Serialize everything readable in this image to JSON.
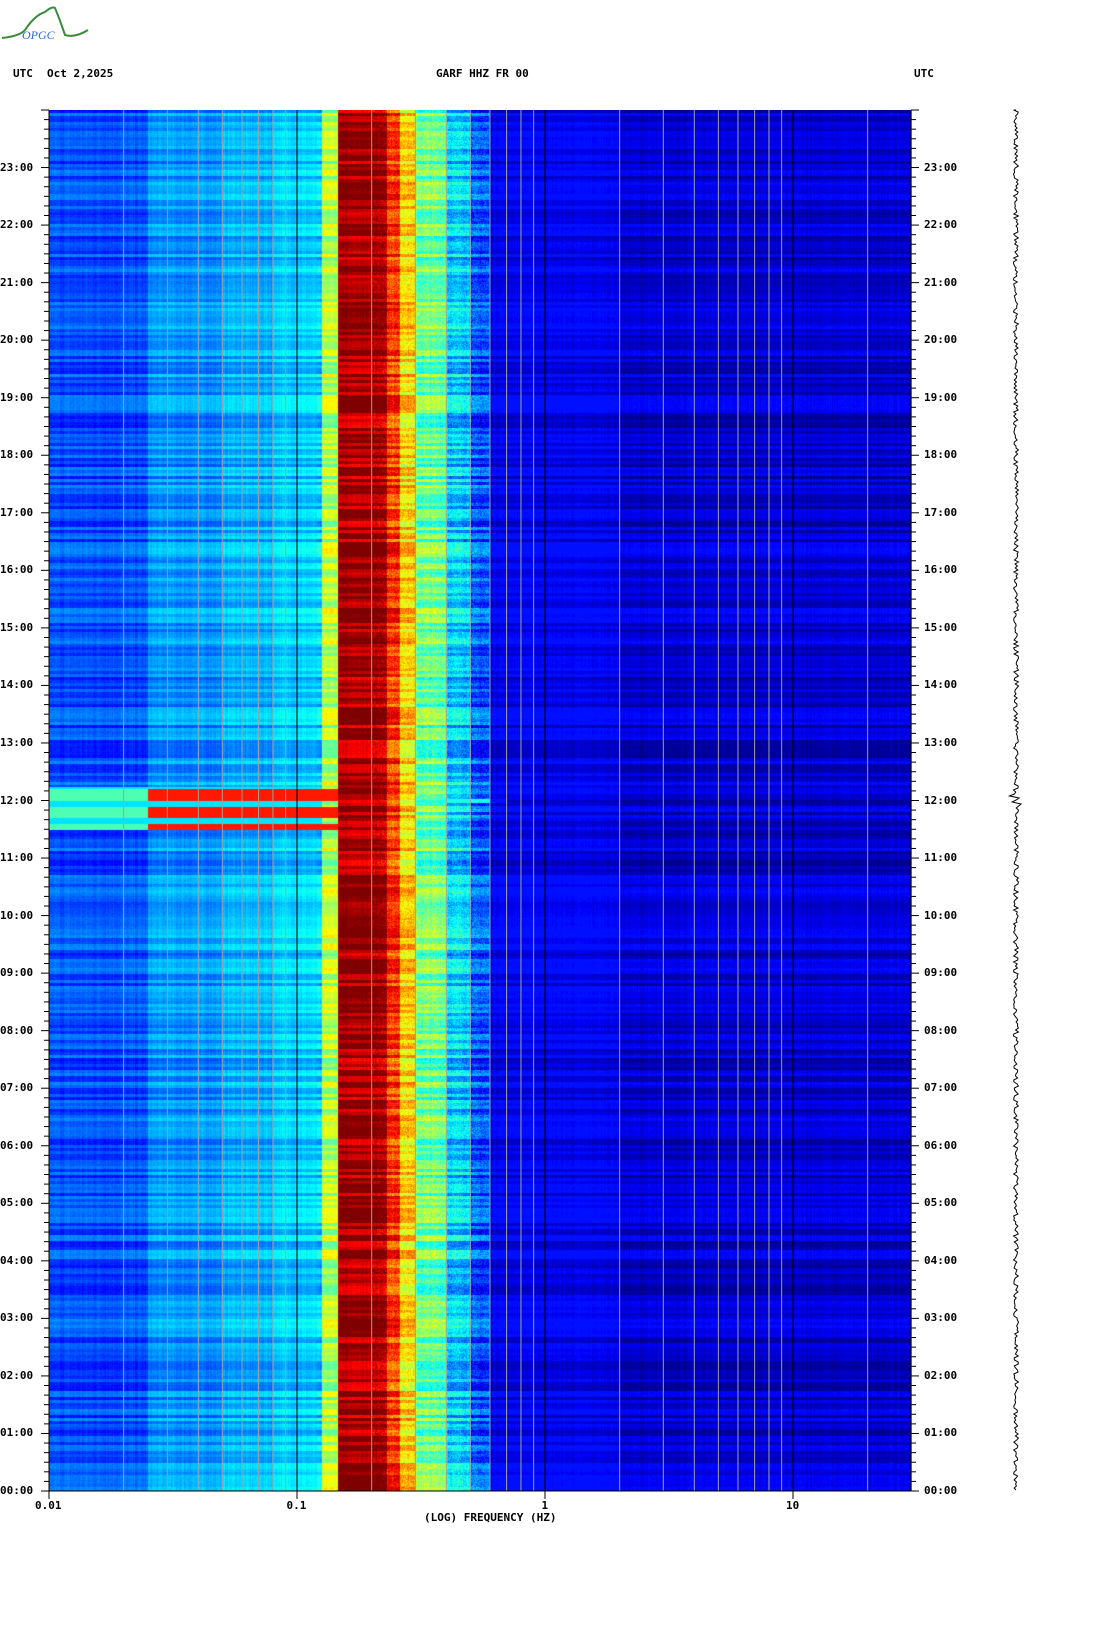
{
  "header": {
    "logo_text": "OPGC",
    "left_tz": "UTC",
    "date": "Oct 2,2025",
    "title": "GARF HHZ FR 00",
    "right_tz": "UTC"
  },
  "colors": {
    "grid_minor": "#a0a0a0",
    "grid_major": "#000000",
    "logo_green": "#3a8a3a",
    "logo_blue": "#2a6ae0"
  },
  "chart_data": {
    "type": "heatmap",
    "title": "GARF HHZ FR 00",
    "xlabel": "(LOG) FREQUENCY (HZ)",
    "ylabel": "UTC",
    "x_scale": "log",
    "xlim": [
      0.01,
      30
    ],
    "ylim_hours": [
      0,
      24
    ],
    "x_ticks": [
      {
        "value": 0.01,
        "label": "0.01"
      },
      {
        "value": 0.1,
        "label": "0.1"
      },
      {
        "value": 1,
        "label": "1"
      },
      {
        "value": 10,
        "label": "10"
      }
    ],
    "y_ticks": [
      "00:00",
      "01:00",
      "02:00",
      "03:00",
      "04:00",
      "05:00",
      "06:00",
      "07:00",
      "08:00",
      "09:00",
      "10:00",
      "11:00",
      "12:00",
      "13:00",
      "14:00",
      "15:00",
      "16:00",
      "17:00",
      "18:00",
      "19:00",
      "20:00",
      "21:00",
      "22:00",
      "23:00"
    ],
    "colormap": "jet",
    "spectral_profile": [
      {
        "f_min": 0.01,
        "f_max": 0.025,
        "level": 0.2
      },
      {
        "f_min": 0.025,
        "f_max": 0.05,
        "level": 0.27
      },
      {
        "f_min": 0.05,
        "f_max": 0.08,
        "level": 0.3
      },
      {
        "f_min": 0.08,
        "f_max": 0.125,
        "level": 0.33
      },
      {
        "f_min": 0.125,
        "f_max": 0.145,
        "level": 0.55
      },
      {
        "f_min": 0.145,
        "f_max": 0.23,
        "level": 0.97
      },
      {
        "f_min": 0.23,
        "f_max": 0.26,
        "level": 0.82
      },
      {
        "f_min": 0.26,
        "f_max": 0.3,
        "level": 0.66
      },
      {
        "f_min": 0.3,
        "f_max": 0.4,
        "level": 0.48
      },
      {
        "f_min": 0.4,
        "f_max": 0.5,
        "level": 0.33
      },
      {
        "f_min": 0.5,
        "f_max": 0.6,
        "level": 0.2
      },
      {
        "f_min": 0.6,
        "f_max": 2,
        "level": 0.12
      },
      {
        "f_min": 2,
        "f_max": 30,
        "level": 0.08
      }
    ],
    "events": [
      {
        "start_hour": 11.5,
        "end_hour": 12.25,
        "f_max": 0.15,
        "level": 0.85,
        "note_freq_line": 0.7
      }
    ]
  }
}
